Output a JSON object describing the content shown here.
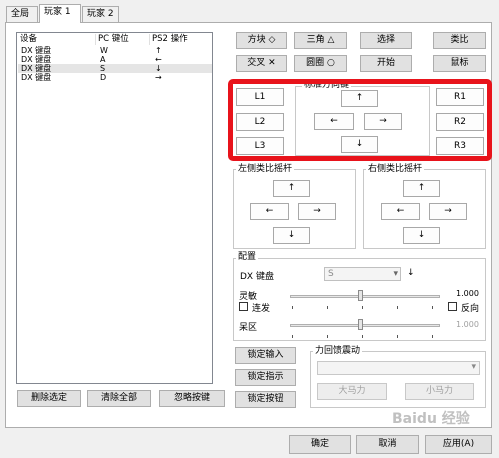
{
  "tabs": [
    {
      "label": "全局"
    },
    {
      "label": "玩家 1"
    },
    {
      "label": "玩家 2"
    }
  ],
  "list": {
    "headers": [
      "设备",
      "PC 键位",
      "PS2 操作"
    ],
    "rows": [
      {
        "device": "DX 键盘",
        "key": "W",
        "action": "↑"
      },
      {
        "device": "DX 键盘",
        "key": "A",
        "action": "←"
      },
      {
        "device": "DX 键盘",
        "key": "S",
        "action": "↓"
      },
      {
        "device": "DX 键盘",
        "key": "D",
        "action": "→"
      }
    ],
    "selected_row": 2
  },
  "list_buttons": {
    "delete": "删除选定",
    "clear": "清除全部",
    "ignore": "忽略按键"
  },
  "face_buttons": {
    "square": "方块 ◇",
    "triangle": "三角 △",
    "select": "选择",
    "analog": "类比",
    "cross": "交叉 ✕",
    "circle": "圆圈 ○",
    "start": "开始",
    "mouse": "鼠标"
  },
  "standard": {
    "label": "标准方向键",
    "l1": "L1",
    "l2": "L2",
    "l3": "L3",
    "r1": "R1",
    "r2": "R2",
    "r3": "R3",
    "up": "↑",
    "left": "←",
    "right": "→",
    "down": "↓"
  },
  "left_stick": {
    "label": "左侧类比摇杆",
    "up": "↑",
    "left": "←",
    "right": "→",
    "down": "↓"
  },
  "right_stick": {
    "label": "右侧类比摇杆",
    "up": "↑",
    "left": "←",
    "right": "→",
    "down": "↓"
  },
  "config": {
    "label": "配置",
    "device_label": "DX 键盘",
    "key_value": "S",
    "arrow": "↓",
    "sensitivity_label": "灵敏",
    "sensitivity_value": "1.000",
    "turbo_label": "连发",
    "reverse_label": "反向",
    "deadzone_label": "呆区",
    "deadzone_value": "1.000"
  },
  "lock_buttons": {
    "input": "锁定输入",
    "direction": "锁定指示",
    "button": "锁定按钮"
  },
  "force_feedback": {
    "label": "力回馈震动",
    "big_motor": "大马力",
    "small_motor": "小马力"
  },
  "dialog": {
    "ok": "确定",
    "cancel": "取消",
    "apply": "应用(A)"
  },
  "watermark": "Baidu 经验",
  "colors": {
    "highlight": "#e8131b",
    "selection": "#e5e5e5"
  }
}
